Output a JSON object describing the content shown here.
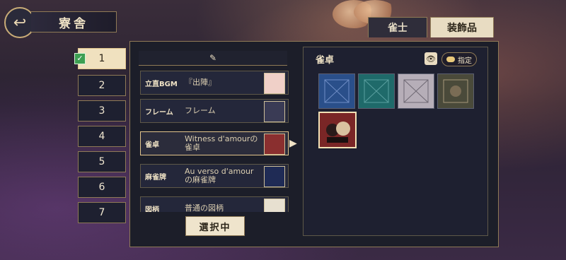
{
  "header": {
    "title": "寮舎"
  },
  "tabs": [
    {
      "label": "雀士"
    },
    {
      "label": "装飾品"
    }
  ],
  "slots": [
    {
      "label": "1",
      "active": true
    },
    {
      "label": "2"
    },
    {
      "label": "3"
    },
    {
      "label": "4"
    },
    {
      "label": "5"
    },
    {
      "label": "6"
    },
    {
      "label": "7"
    }
  ],
  "items": [
    {
      "category": "立直BGM",
      "value": "『出陣』"
    },
    {
      "category": "フレーム",
      "value": "フレーム"
    },
    {
      "category": "雀卓",
      "value": "Witness d'amourの雀卓",
      "selected": true
    },
    {
      "category": "麻雀牌",
      "value": "Au verso d'amourの麻雀牌"
    },
    {
      "category": "図柄",
      "value": "普通の図柄"
    }
  ],
  "select_button": "選択中",
  "preview": {
    "title": "雀卓",
    "pin_label": "指定"
  },
  "icons": {
    "back": "back-arrow-icon",
    "edit": "edit-icon",
    "eye": "eye-icon",
    "arrow": "chevron-right-icon"
  },
  "colors": {
    "accent": "#e2c58c",
    "panel": "#1c1e29"
  }
}
